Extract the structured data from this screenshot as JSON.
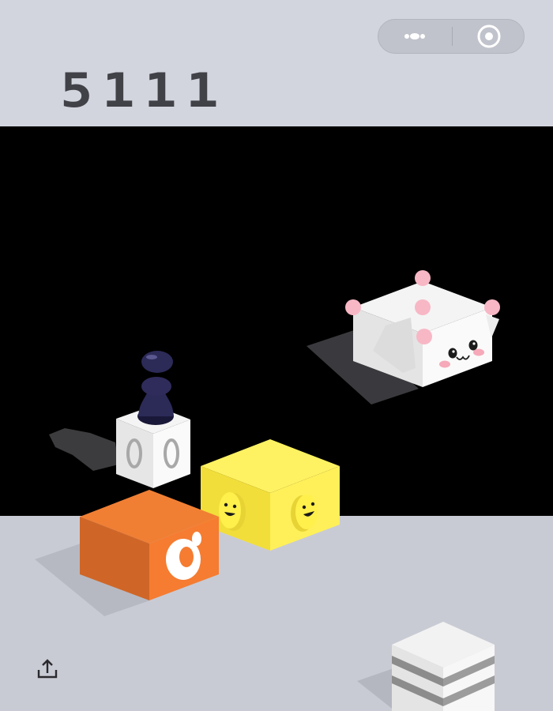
{
  "hud": {
    "score": "5111"
  },
  "capsule": {
    "more_icon": "more-dots-icon",
    "close_icon": "target-circle-icon"
  },
  "share": {
    "icon": "share-upload-icon"
  },
  "colors": {
    "top_bg": "#d3d5de",
    "play_bg": "#000000",
    "floor_bg": "#c9cbd4",
    "score_text": "#414148",
    "orange_block": "#f07f34",
    "yellow_block": "#fff262",
    "white_block": "#f2f2f2",
    "player_piece": "#2c2a57",
    "pink_dots": "#f8b7c5"
  }
}
